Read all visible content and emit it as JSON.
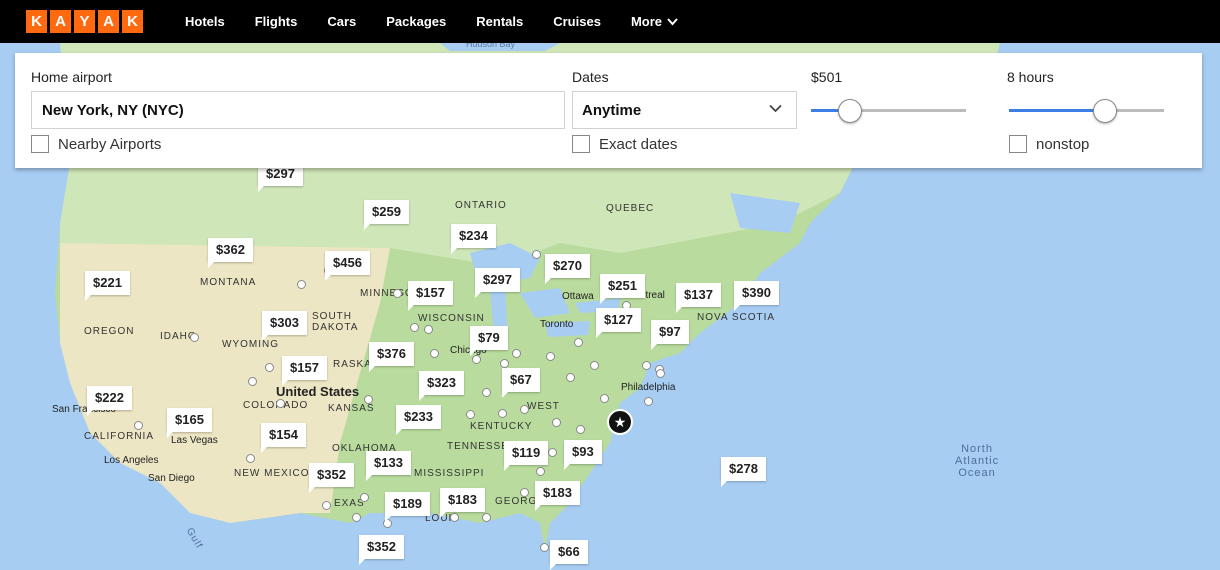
{
  "logo": {
    "letters": [
      "K",
      "A",
      "Y",
      "A",
      "K"
    ]
  },
  "nav": {
    "items": [
      "Hotels",
      "Flights",
      "Cars",
      "Packages",
      "Rentals",
      "Cruises",
      "More"
    ]
  },
  "search": {
    "home_airport_label": "Home airport",
    "home_airport_value": "New York, NY (NYC)",
    "nearby_label": "Nearby Airports",
    "dates_label": "Dates",
    "dates_value": "Anytime",
    "exact_dates_label": "Exact dates",
    "price_label": "$501",
    "price_level_pct": 25,
    "duration_label": "8 hours",
    "duration_level_pct": 62,
    "nonstop_label": "nonstop"
  },
  "map_labels": {
    "hudson_bay": "Hudson Bay",
    "ontario": "ONTARIO",
    "quebec": "QUEBEC",
    "montana": "MONTANA",
    "oregon": "OREGON",
    "idaho": "IDAHO",
    "wyoming": "WYOMING",
    "south_dakota": "SOUTH\nDAKOTA",
    "minnesota": "MINNESO",
    "wisconsin": "WISCONSIN",
    "nebraska": "RASKA",
    "kansas": "KANSAS",
    "colorado": "COLORADO",
    "california": "CALIFORNIA",
    "new_mexico": "NEW MEXICO",
    "oklahoma": "OKLAHOMA",
    "tennessee": "TENNESSEE",
    "kentucky": "KENTUCKY",
    "west": "WEST",
    "mississippi": "MISSISSIPPI",
    "georgia": "GEORGIA",
    "texas": "EXAS",
    "louisiana": "LOUIS",
    "nova_scotia": "NOVA SCOTIA",
    "united_states": "United States",
    "ottawa": "Ottawa",
    "montreal": "Montreal",
    "toronto": "Toronto",
    "chicago": "Chicago",
    "philadelphia": "Philadelphia",
    "san_francisco": "San Francisco",
    "las_vegas": "Las Vegas",
    "los_angeles": "Los Angeles",
    "san_diego": "San Diego",
    "north_atlantic": "North\nAtlantic\nOcean",
    "gulf": "Gulf"
  },
  "prices": [
    "$297",
    "$259",
    "$234",
    "$362",
    "$456",
    "$270",
    "$297",
    "$221",
    "$157",
    "$251",
    "$137",
    "$390",
    "$303",
    "$127",
    "$97",
    "$79",
    "$376",
    "$157",
    "$323",
    "$67",
    "$222",
    "$233",
    "$165",
    "$154",
    "$119",
    "$93",
    "$278",
    "$133",
    "$352",
    "$183",
    "$189",
    "$183",
    "$352",
    "$66"
  ],
  "colors": {
    "kayak_orange": "#ff690f",
    "slider_blue": "#3d7ee6",
    "water": "#a7cdf3"
  }
}
